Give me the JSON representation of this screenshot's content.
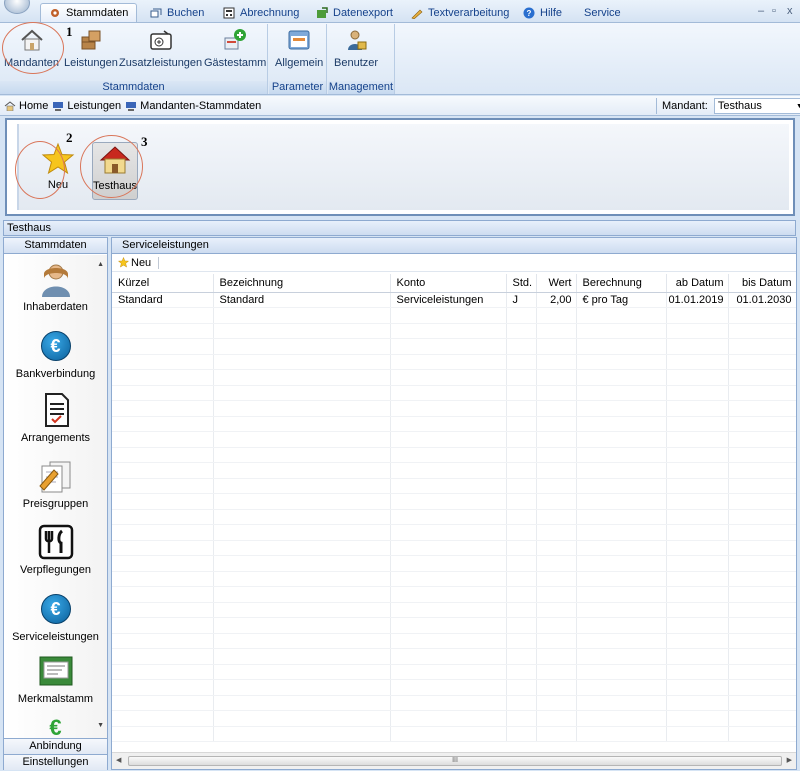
{
  "tabs": [
    {
      "label": "Stammdaten",
      "icon": "gear-tab-icon",
      "active": true
    },
    {
      "label": "Buchen",
      "icon": "booking-icon"
    },
    {
      "label": "Abrechnung",
      "icon": "billing-icon"
    },
    {
      "label": "Datenexport",
      "icon": "export-icon"
    },
    {
      "label": "Textverarbeitung",
      "icon": "text-icon"
    },
    {
      "label": "Hilfe",
      "icon": "help-icon"
    },
    {
      "label": "Service",
      "icon": ""
    }
  ],
  "window_controls": {
    "minimize": "–",
    "restore": "▫",
    "close": "x"
  },
  "ribbon": {
    "groups": [
      {
        "label": "Stammdaten",
        "buttons": [
          "Mandanten",
          "Leistungen",
          "Zusatzleistungen",
          "Gästestamm"
        ]
      },
      {
        "label": "Parameter",
        "buttons": [
          "Allgemein"
        ]
      },
      {
        "label": "Management",
        "buttons": [
          "Benutzer"
        ]
      }
    ]
  },
  "annotations": [
    "1",
    "2",
    "3"
  ],
  "breadcrumb": [
    "Home",
    "Leistungen",
    "Mandanten-Stammdaten"
  ],
  "mandant": {
    "label": "Mandant:",
    "value": "Testhaus"
  },
  "mandant_buttons": [
    "Neu",
    "Testhaus"
  ],
  "section_title": "Testhaus",
  "leftnav": {
    "header": "Stammdaten",
    "items": [
      "Inhaberdaten",
      "Bankverbindung",
      "Arrangements",
      "Preisgruppen",
      "Verpflegungen",
      "Serviceleistungen",
      "Merkmalstamm",
      "Anbindung"
    ],
    "footer": "Einstellungen"
  },
  "main": {
    "header": "Serviceleistungen",
    "new_label": "Neu",
    "columns": [
      "Kürzel",
      "Bezeichnung",
      "Konto",
      "Std.",
      "Wert",
      "Berechnung",
      "ab Datum",
      "bis Datum"
    ],
    "rows": [
      [
        "Standard",
        "Standard",
        "Serviceleistungen",
        "J",
        "2,00",
        "€ pro Tag",
        "01.01.2019",
        "01.01.2030"
      ]
    ],
    "scroll_thumb": "III"
  }
}
